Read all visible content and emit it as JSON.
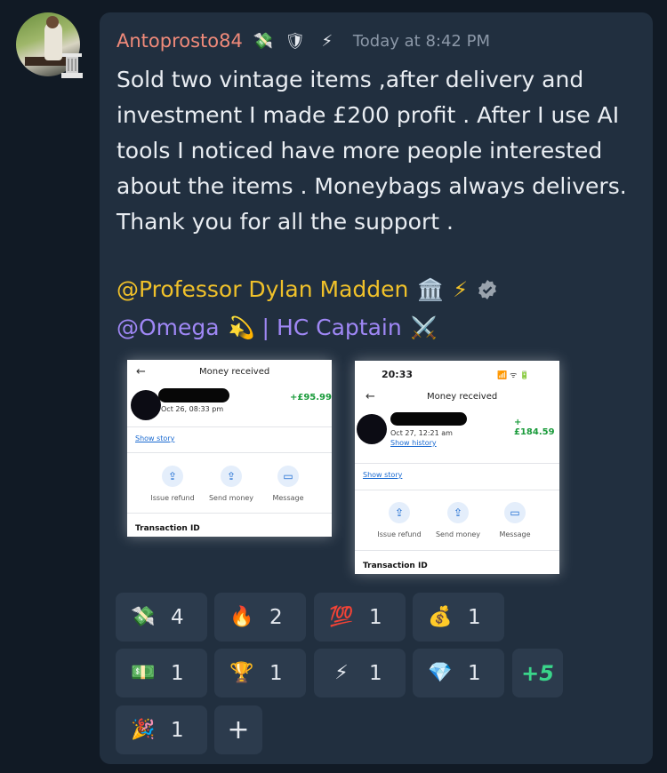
{
  "post": {
    "username": "Antoprosto84",
    "badges": [
      "💸",
      "🛡",
      "⚡"
    ],
    "timestamp": "Today at 8:42 PM",
    "message": "Sold two vintage items ,after delivery and investment I made £200 profit . After I use AI tools I noticed have more people interested about the items . Moneybags always delivers. Thank you for all the support .",
    "mention_professor": {
      "name": "@Professor Dylan Madden",
      "emoji": "🏛️",
      "emoji2": "⚡",
      "verified_icon": "verified-badge-icon"
    },
    "mention_omega": {
      "name": "@Omega",
      "emoji": "💫",
      "separator": "|",
      "role": "HC Captain",
      "role_emoji": "⚔️"
    }
  },
  "screenshots": [
    {
      "title": "Money received",
      "amount": "+£95.99",
      "date": "Oct 26, 08:33 pm",
      "show_story": "Show story",
      "actions": [
        "Issue refund",
        "Send money",
        "Message"
      ],
      "transaction_label": "Transaction ID"
    },
    {
      "status_time": "20:33",
      "status_icons": "📶 ᯤ 🔋",
      "title": "Money received",
      "amount": "+£184.59",
      "date": "Oct 27, 12:21 am",
      "show_history": "Show history",
      "show_story": "Show story",
      "actions": [
        "Issue refund",
        "Send money",
        "Message"
      ],
      "transaction_label": "Transaction ID"
    }
  ],
  "reactions": [
    {
      "emoji": "💸",
      "count": "4"
    },
    {
      "emoji": "🔥",
      "count": "2"
    },
    {
      "emoji": "💯",
      "count": "1"
    },
    {
      "emoji": "💰",
      "count": "1"
    },
    {
      "emoji": "💵",
      "count": "1"
    },
    {
      "emoji": "🏆",
      "count": "1"
    },
    {
      "emoji": "⚡",
      "count": "1"
    },
    {
      "emoji": "💎",
      "count": "1"
    },
    {
      "emoji": "🎉",
      "count": "1"
    }
  ],
  "more_reactions": "+5",
  "add_reaction": "+"
}
